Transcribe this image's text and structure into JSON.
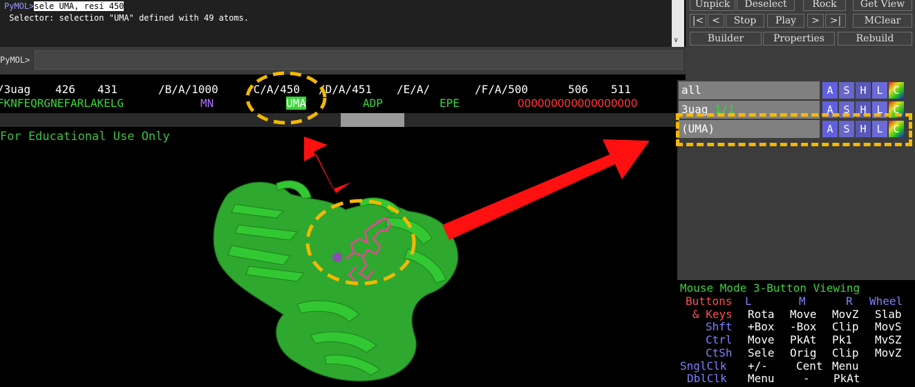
{
  "log": {
    "prompt": "PyMOL>",
    "command": "sele UMA, resi 450",
    "output": " Selector: selection \"UMA\" defined with 49 atoms."
  },
  "command_line": {
    "prompt": "PyMOL>",
    "value": ""
  },
  "controls": {
    "row1": [
      "Unpick",
      "Deselect",
      "Rock",
      "Get View"
    ],
    "row2": [
      "|<",
      "<",
      "Stop",
      "Play",
      ">",
      ">|",
      "MClear"
    ],
    "row3": [
      "Builder",
      "Properties",
      "Rebuild"
    ]
  },
  "sequence": {
    "header": {
      "obj": "/3uag",
      "n426": "426",
      "n431": "431",
      "b": "/B/A/1000",
      "c": "/C/A/450",
      "d": "/D/A/451",
      "e": "/E/A/",
      "f": "/F/A/500",
      "n506": "506",
      "n511": "511"
    },
    "residues": {
      "protein": "FKNFEQRGNEFARLAKELG",
      "mn": "MN",
      "uma": "UMA",
      "adp": "ADP",
      "epe": "EPE",
      "water": "OOOOOOOOOOOOOOOOOO"
    }
  },
  "viewer": {
    "watermark": "For Educational Use Only"
  },
  "objects": [
    {
      "name": "all",
      "count": ""
    },
    {
      "name": "3uag",
      "count": "1/1"
    },
    {
      "name": "(UMA)",
      "count": ""
    }
  ],
  "obj_buttons": [
    "A",
    "S",
    "H",
    "L",
    "C"
  ],
  "mouse_mode": {
    "title": "Mouse Mode 3-Button Viewing",
    "buttons_label": "Buttons",
    "col_l": "L",
    "col_m": "M",
    "col_r": "R",
    "col_wheel": "Wheel",
    "rows": [
      {
        "key": "& Keys",
        "l": "Rota",
        "m": "Move",
        "r": "MovZ",
        "w": "Slab"
      },
      {
        "key": "Shft",
        "l": "+Box",
        "m": "-Box",
        "r": "Clip",
        "w": "MovS"
      },
      {
        "key": "Ctrl",
        "l": "Move",
        "m": "PkAt",
        "r": "Pk1",
        "w": "MvSZ"
      },
      {
        "key": "CtSh",
        "l": "Sele",
        "m": "Orig",
        "r": "Clip",
        "w": "MovZ"
      },
      {
        "key": "SnglClk",
        "l": "+/-",
        "m": "Cent",
        "r": "Menu",
        "w": ""
      },
      {
        "key": "DblClk",
        "l": "Menu",
        "m": "-",
        "r": "PkAt",
        "w": ""
      }
    ]
  },
  "colors": {
    "highlight": "#f5b800",
    "arrow": "#ff1010",
    "protein": "#39d639",
    "ligand": "#ff3aa8"
  }
}
